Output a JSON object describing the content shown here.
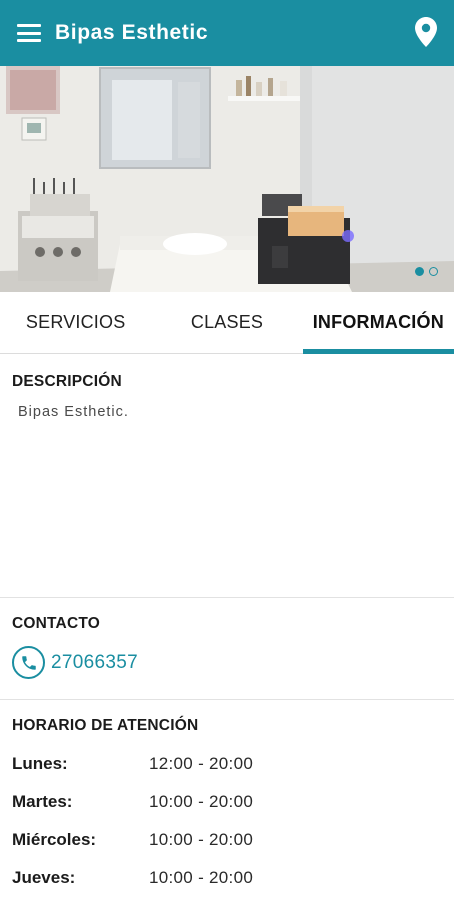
{
  "app_bar": {
    "title": "Bipas Esthetic",
    "menu_icon": "menu-icon",
    "location_icon": "location-pin-icon",
    "background_color": "#1a8ea1"
  },
  "carousel": {
    "slide_count": 2,
    "active_index": 0
  },
  "tabs": [
    {
      "label": "SERVICIOS",
      "active": false
    },
    {
      "label": "CLASES",
      "active": false
    },
    {
      "label": "INFORMACIÓN",
      "active": true
    }
  ],
  "description": {
    "heading": "DESCRIPCIÓN",
    "text": "Bipas Esthetic."
  },
  "contact": {
    "heading": "CONTACTO",
    "phone_icon": "phone-icon",
    "phone": "27066357"
  },
  "hours": {
    "heading": "HORARIO DE ATENCIÓN",
    "rows": [
      {
        "day": "Lunes:",
        "time": "12:00 - 20:00"
      },
      {
        "day": "Martes:",
        "time": "10:00 - 20:00"
      },
      {
        "day": "Miércoles:",
        "time": "10:00 - 20:00"
      },
      {
        "day": "Jueves:",
        "time": "10:00 - 20:00"
      }
    ]
  },
  "accent_color": "#1a8ea1"
}
